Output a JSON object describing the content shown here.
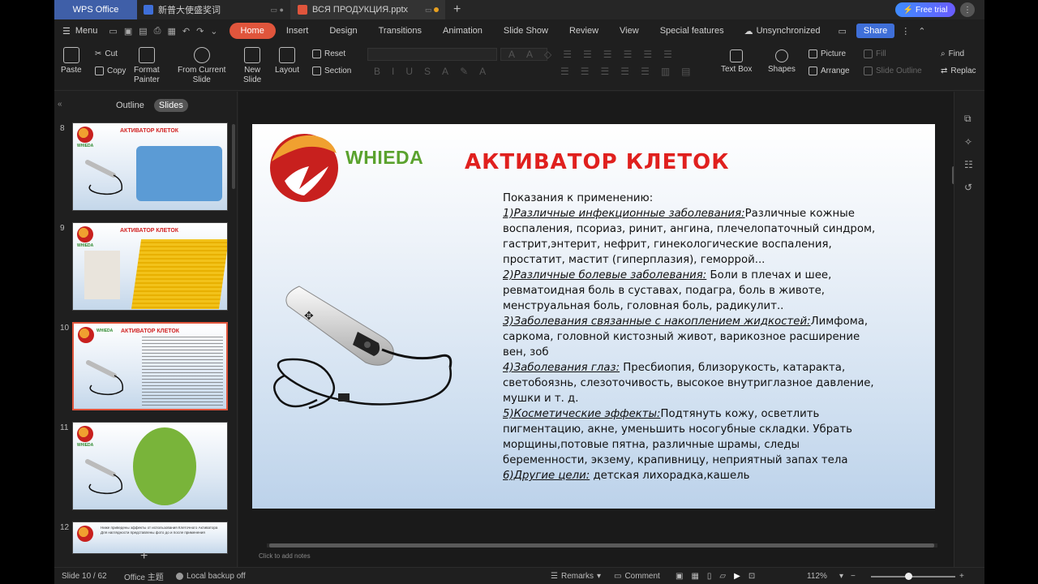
{
  "titlebar": {
    "tabs": [
      {
        "label": "WPS Office"
      },
      {
        "label": "新普大使盛奖词"
      },
      {
        "label": "ВСЯ ПРОДУКЦИЯ.pptx"
      }
    ],
    "free_trial": "Free trial"
  },
  "menubar": {
    "menu_label": "Menu",
    "tabs": [
      "Home",
      "Insert",
      "Design",
      "Transitions",
      "Animation",
      "Slide Show",
      "Review",
      "View",
      "Special features"
    ],
    "unsync": "Unsynchronized",
    "share": "Share"
  },
  "ribbon": {
    "paste": "Paste",
    "cut": "Cut",
    "copy": "Copy",
    "format_painter_1": "Format",
    "format_painter_2": "Painter",
    "from_current_1": "From Current",
    "from_current_2": "Slide",
    "new_slide_1": "New",
    "new_slide_2": "Slide",
    "layout": "Layout",
    "reset": "Reset",
    "section": "Section",
    "text_box": "Text Box",
    "shapes": "Shapes",
    "picture": "Picture",
    "arrange": "Arrange",
    "fill": "Fill",
    "slide_outline": "Slide Outline",
    "find": "Find",
    "replace": "Replac"
  },
  "panel": {
    "outline_tab": "Outline",
    "slides_tab": "Slides",
    "thumbs": [
      {
        "num": "8",
        "title": "АКТИВАТОР КЛЕТОК",
        "brand": "WHIEDA"
      },
      {
        "num": "9",
        "title": "АКТИВАТОР КЛЕТОК",
        "brand": "WHIEDA"
      },
      {
        "num": "10",
        "title": "АКТИВАТОР КЛЕТОК",
        "brand": "WHIEDA"
      },
      {
        "num": "11",
        "title": "",
        "brand": "WHIEDA"
      },
      {
        "num": "12",
        "title": "",
        "brand": "WHIEDA"
      }
    ],
    "thumb12_text": "Ниже приведены эффекты от использования Клеточного Активатора Для наглядности представлены фото до и после применения"
  },
  "slide": {
    "brand": "WHIEDA",
    "title": "АКТИВАТОР КЛЕТОК",
    "intro": "Показания к применению:",
    "sections": [
      {
        "head": "1)Различные инфекционные заболевания:",
        "text": "Различные кожные воспаления, псориаз, ринит, ангина, плечелопаточный синдром, гастрит,энтерит, нефрит, гинекологические воспаления, простатит, мастит (гиперплазия), геморрой..."
      },
      {
        "head": "2)Различные болевые заболевания:",
        "text": " Боли в плечах и шее, ревматоидная боль в суставах, подагра, боль в животе, менструальная боль, головная боль, радикулит.."
      },
      {
        "head": "3)Заболевания связанные с накоплением жидкостей:",
        "text": "Лимфома, саркома, головной кистозный живот, варикозное расширение вен, зоб"
      },
      {
        "head": "4)Заболевания глаз:",
        "text": " Пресбиопия, близорукость, катаракта, светобоязнь, слезоточивость, высокое внутриглазное давление, мушки и т. д."
      },
      {
        "head": "5)Косметические эффекты:",
        "text": "Подтянуть кожу, осветлить пигментацию, акне, уменьшить носогубные складки. Убрать морщины,потовые пятна, различные шрамы, следы беременности, экзему, крапивницу, неприятный запах тела"
      },
      {
        "head": "6)Другие цели:",
        "text": " детская лихорадка,кашель"
      }
    ]
  },
  "notes_placeholder": "Click to add notes",
  "status": {
    "slide_count": "Slide 10 / 62",
    "theme": "Office 主题",
    "backup": "Local backup off",
    "remarks": "Remarks",
    "comment": "Comment",
    "zoom": "112%"
  },
  "colors": {
    "accent": "#e0553c",
    "title_red": "#e0201e",
    "brand_green": "#5aa22e"
  }
}
